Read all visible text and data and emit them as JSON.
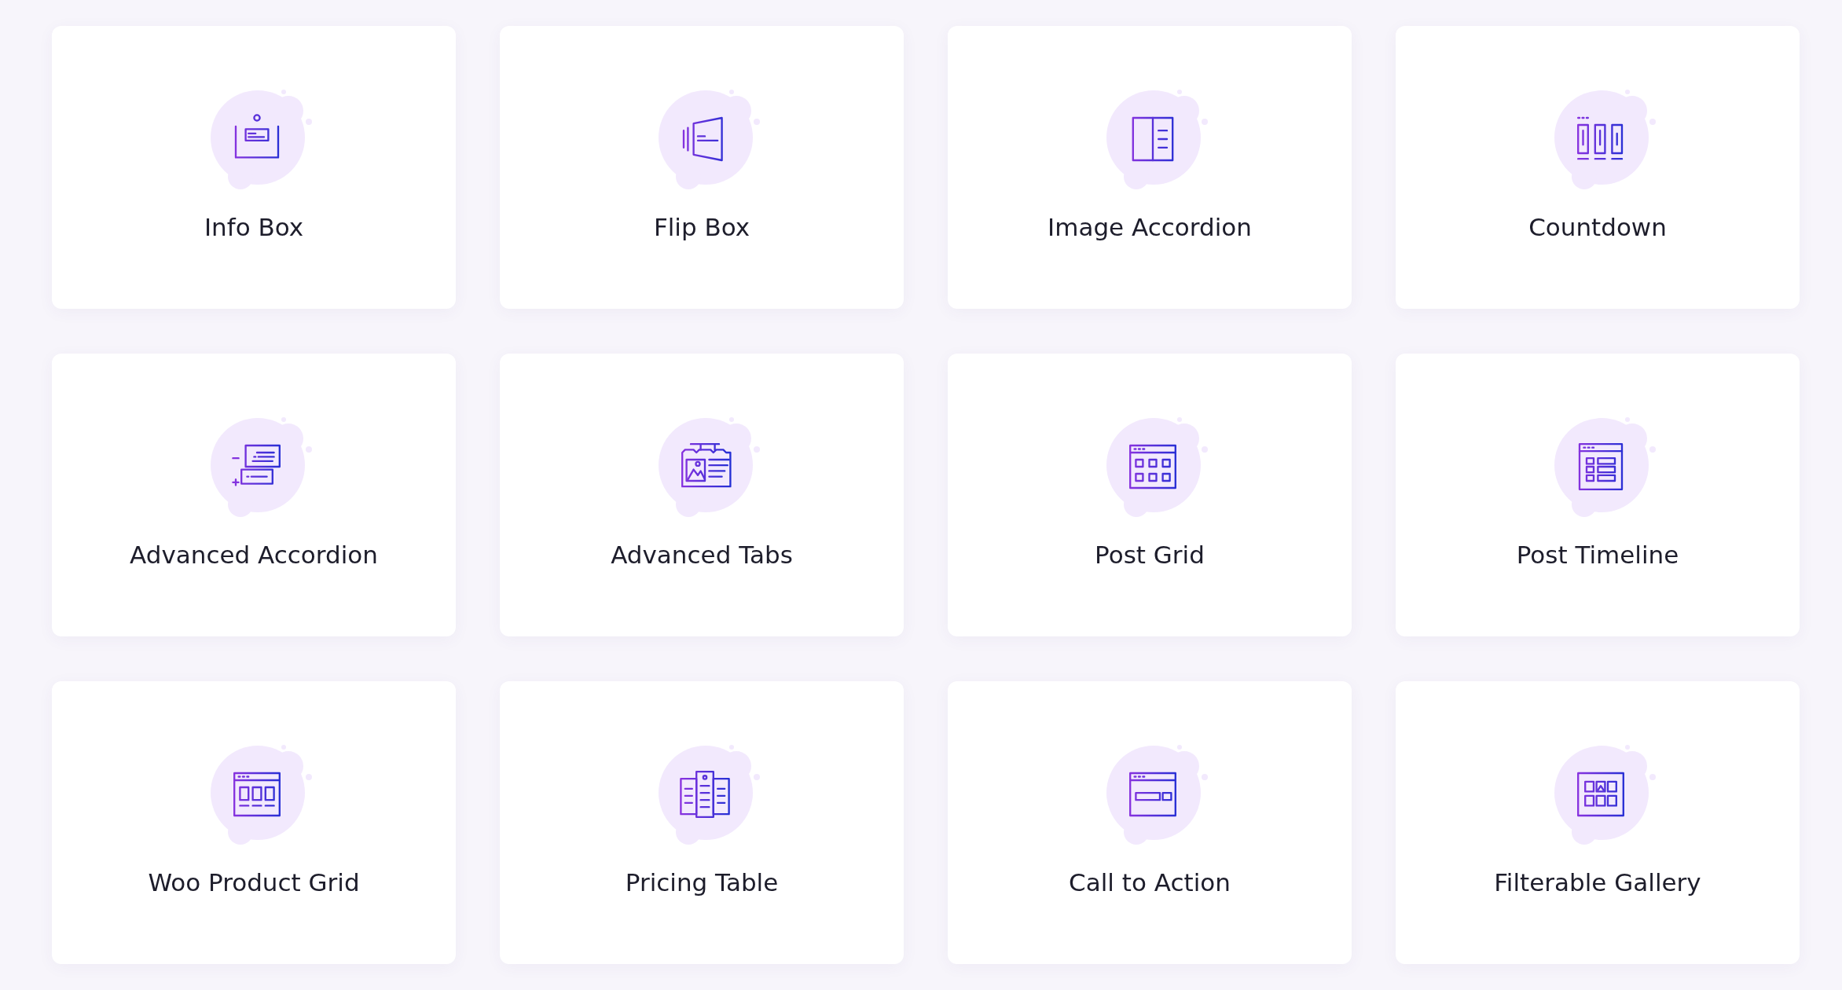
{
  "cards": [
    {
      "label": "Info Box",
      "kind": "infobox"
    },
    {
      "label": "Flip Box",
      "kind": "flipbox"
    },
    {
      "label": "Image Accordion",
      "kind": "imageaccordion"
    },
    {
      "label": "Countdown",
      "kind": "countdown"
    },
    {
      "label": "Advanced Accordion",
      "kind": "accordion"
    },
    {
      "label": "Advanced Tabs",
      "kind": "tabs"
    },
    {
      "label": "Post Grid",
      "kind": "postgrid"
    },
    {
      "label": "Post Timeline",
      "kind": "timeline"
    },
    {
      "label": "Woo Product Grid",
      "kind": "productgrid"
    },
    {
      "label": "Pricing Table",
      "kind": "pricing"
    },
    {
      "label": "Call to Action",
      "kind": "cta"
    },
    {
      "label": "Filterable Gallery",
      "kind": "gallery"
    }
  ]
}
